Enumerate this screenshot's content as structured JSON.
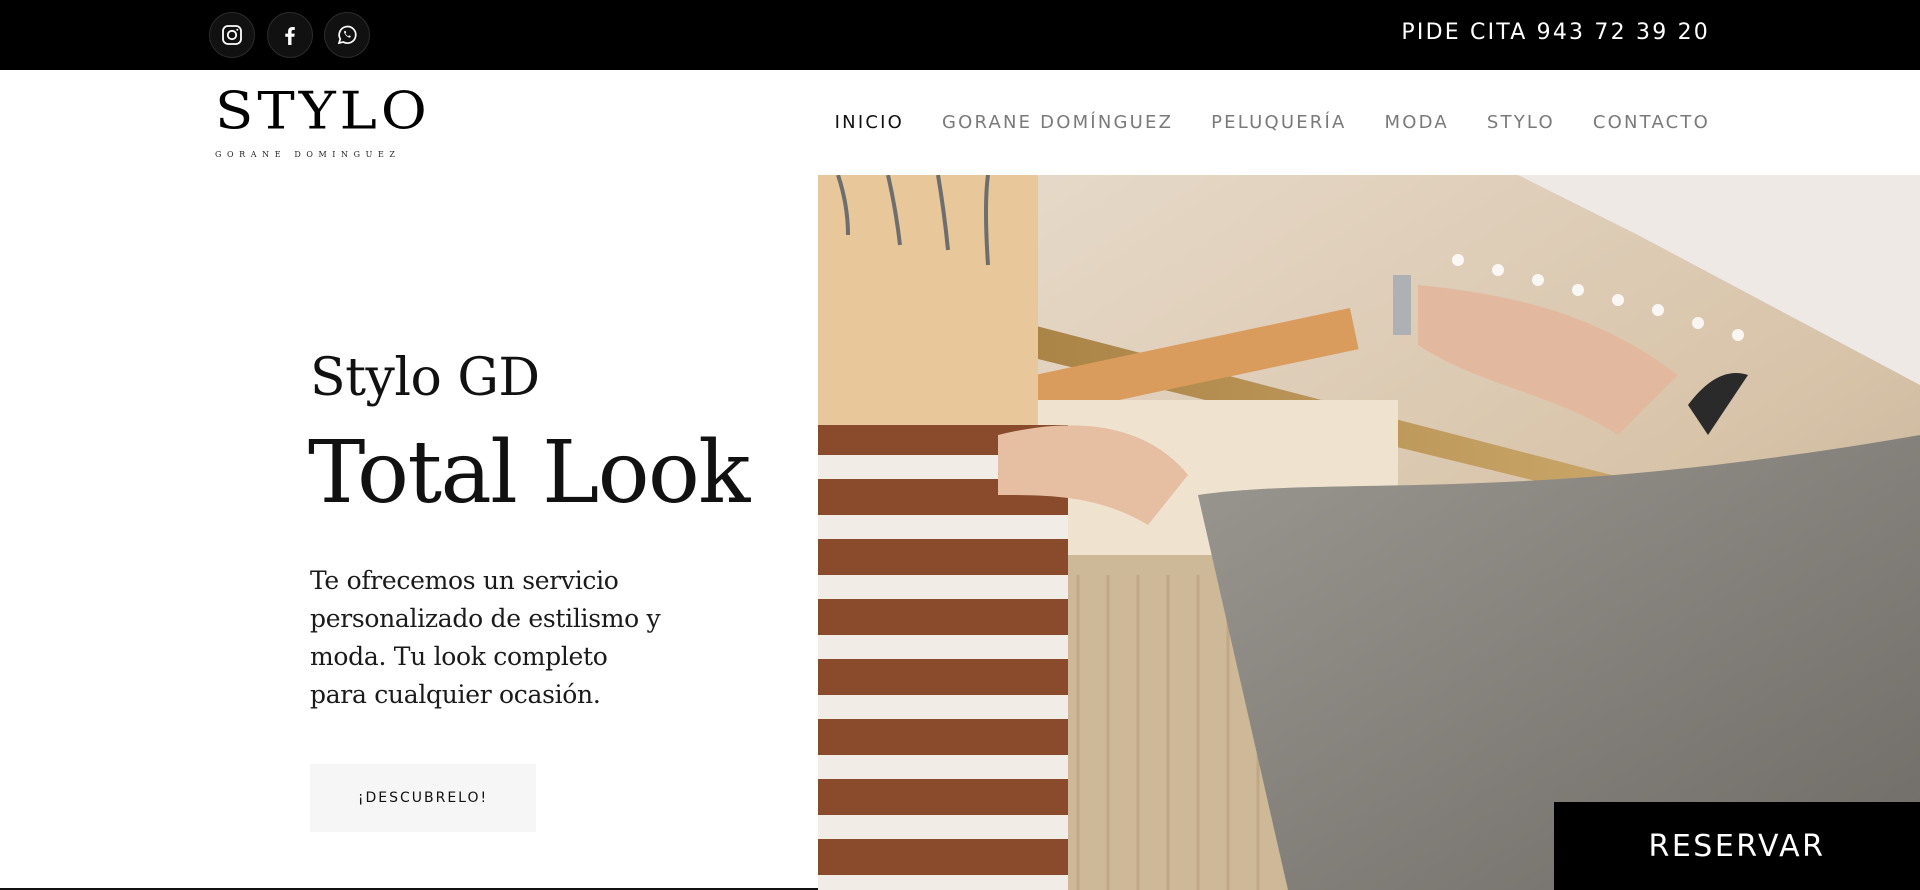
{
  "topbar": {
    "social": [
      {
        "name": "instagram-icon"
      },
      {
        "name": "facebook-icon"
      },
      {
        "name": "whatsapp-icon"
      }
    ],
    "callout": "PIDE CITA 943 72 39 20"
  },
  "header": {
    "logo": {
      "word": "STYLO",
      "subtitle": "GORANE DOMINGUEZ"
    },
    "nav": [
      {
        "label": "INICIO",
        "active": true
      },
      {
        "label": "GORANE DOMÍNGUEZ",
        "active": false
      },
      {
        "label": "PELUQUERÍA",
        "active": false
      },
      {
        "label": "MODA",
        "active": false
      },
      {
        "label": "STYLO",
        "active": false
      },
      {
        "label": "CONTACTO",
        "active": false
      }
    ]
  },
  "hero": {
    "subtitle": "Stylo GD",
    "title": "Total Look",
    "text": "Te ofrecemos un servicio personalizado de estilismo y moda. Tu look completo para cualquier ocasión.",
    "cta_label": "¡DESCUBRELO!"
  },
  "reserve_label": "RESERVAR",
  "colors": {
    "topbar": "#000000",
    "accent": "#000000",
    "muted_nav": "#7a7a7a"
  }
}
